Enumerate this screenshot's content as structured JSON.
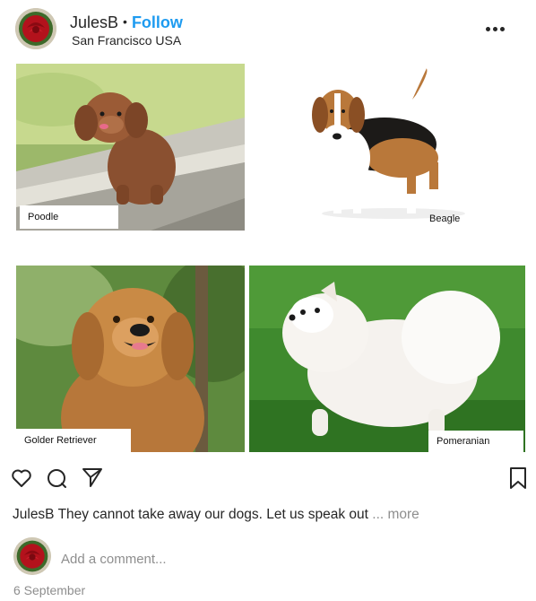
{
  "post": {
    "username": "JulesB",
    "separator": "•",
    "follow_label": "Follow",
    "location": "San Francisco USA",
    "more_icon": "more-horizontal-icon",
    "avatar_icon": "red-rose-avatar"
  },
  "photos": [
    {
      "label": "Poodle"
    },
    {
      "label": "Beagle"
    },
    {
      "label": "Golder Retriever"
    },
    {
      "label": "Pomeranian"
    }
  ],
  "actions": {
    "like_icon": "heart-icon",
    "comment_icon": "comment-bubble-icon",
    "share_icon": "paper-plane-icon",
    "save_icon": "bookmark-icon"
  },
  "caption": {
    "username": "JulesB",
    "text": "They cannot take away our dogs. Let us speak out",
    "more_label": "... more"
  },
  "comment": {
    "placeholder": "Add a comment..."
  },
  "date": "6 September",
  "colors": {
    "follow": "#1e9bf0",
    "muted": "#8e8e8e",
    "text": "#262626"
  }
}
